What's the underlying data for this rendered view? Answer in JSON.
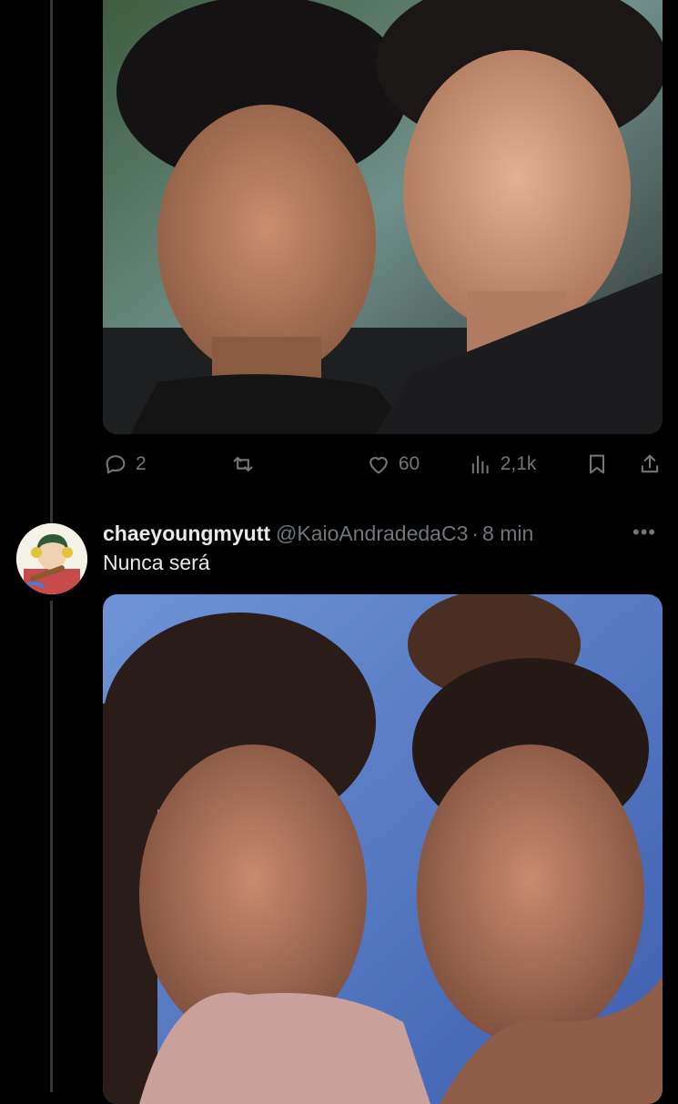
{
  "previous_tweet": {
    "media_alt": "photo",
    "actions": {
      "reply": {
        "icon": "reply-icon",
        "count": "2"
      },
      "retweet": {
        "icon": "retweet-icon",
        "count": ""
      },
      "like": {
        "icon": "heart-icon",
        "count": "60"
      },
      "views": {
        "icon": "views-icon",
        "count": "2,1k"
      },
      "bookmark": {
        "icon": "bookmark-icon"
      },
      "share": {
        "icon": "share-icon"
      }
    }
  },
  "tweet": {
    "display_name": "chaeyoungmyutt",
    "handle": "@KaioAndradedaC3",
    "separator": "·",
    "time": "8 min",
    "more": "•••",
    "text": "Nunca será",
    "media_alt": "photo"
  },
  "colors": {
    "background": "#000000",
    "text_primary": "#e7e9ea",
    "text_secondary": "#71767b",
    "thread_line": "#333639"
  }
}
